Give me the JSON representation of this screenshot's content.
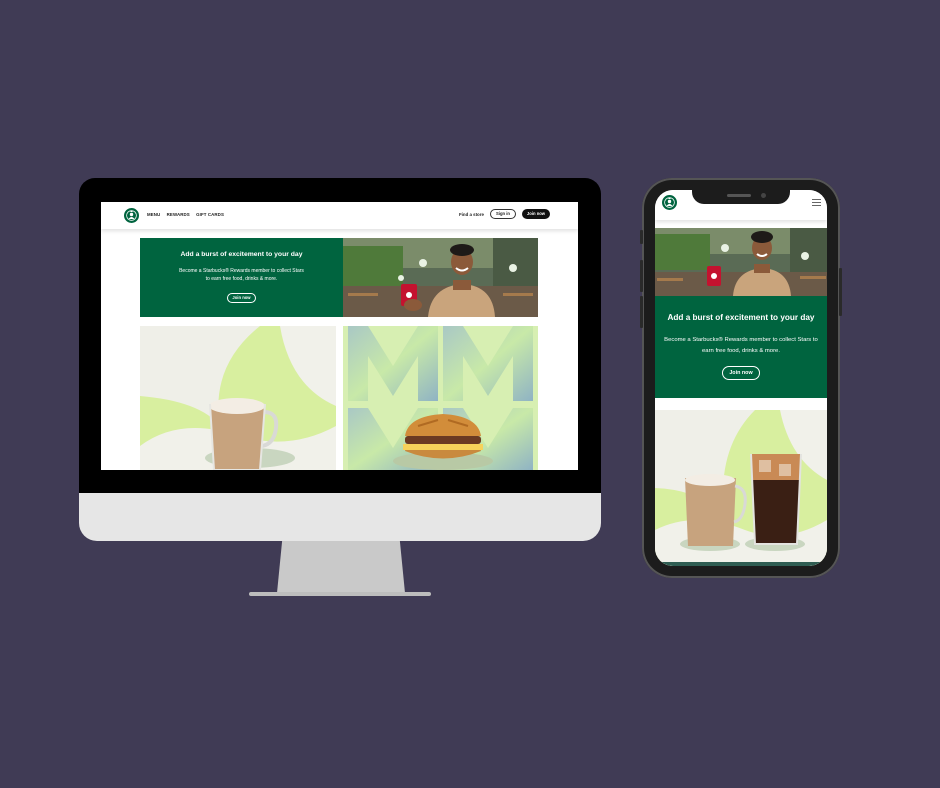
{
  "colors": {
    "background": "#403b55",
    "brand_green": "#00643f",
    "button_dark": "#111111"
  },
  "desktop": {
    "nav": {
      "logo_icon": "starbucks-siren-logo",
      "links": [
        "MENU",
        "REWARDS",
        "GIFT CARDS"
      ],
      "find_store": "Find a store",
      "sign_in": "Sign in",
      "join_now": "Join now"
    },
    "hero": {
      "title": "Add a burst of excitement to your day",
      "text_line1": "Become a Starbucks® Rewards member to collect Stars",
      "text_line2": "to earn free food, drinks & more.",
      "button": "Join now"
    }
  },
  "mobile": {
    "header": {
      "logo_icon": "starbucks-siren-logo",
      "menu_icon": "hamburger-menu-icon"
    },
    "hero": {
      "title": "Add a burst of excitement to your day",
      "text_line1": "Become a Starbucks® Rewards member to collect Stars to",
      "text_line2": "earn free food, drinks & more.",
      "button": "Join now"
    }
  }
}
